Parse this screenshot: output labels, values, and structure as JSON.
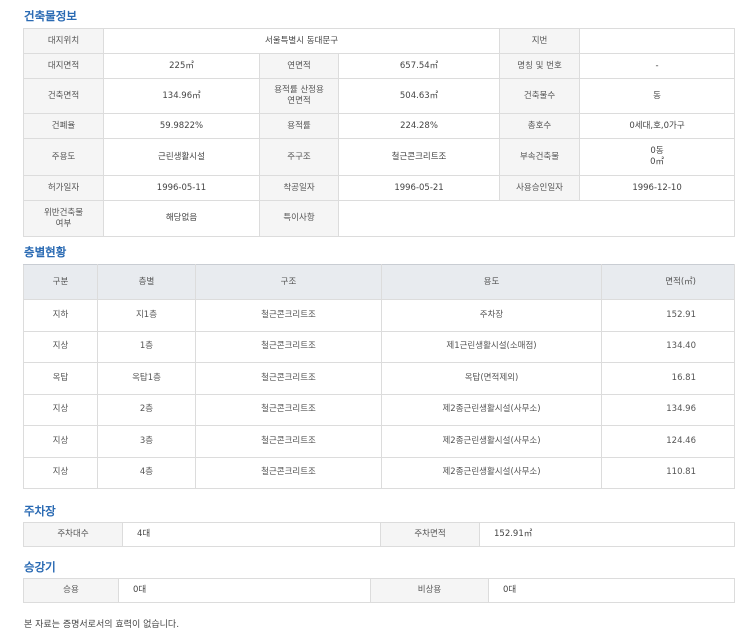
{
  "building": {
    "title": "건축물정보",
    "rows": [
      {
        "cells": [
          {
            "label": "대지위치",
            "value": "서울특별시 동대문구",
            "colspan": 3
          },
          {
            "label": "지번",
            "value": ""
          }
        ]
      },
      {
        "cells": [
          {
            "label": "대지면적",
            "value": "225㎡"
          },
          {
            "label": "연면적",
            "value": "657.54㎡"
          },
          {
            "label": "명칭 및 번호",
            "value": "-"
          }
        ]
      },
      {
        "cells": [
          {
            "label": "건축면적",
            "value": "134.96㎡"
          },
          {
            "label": "용적률 산정용\n연면적",
            "value": "504.63㎡"
          },
          {
            "label": "건축물수",
            "value": "동"
          }
        ]
      },
      {
        "cells": [
          {
            "label": "건폐율",
            "value": "59.9822%"
          },
          {
            "label": "용적률",
            "value": "224.28%"
          },
          {
            "label": "총호수",
            "value": "0세대,호,0가구"
          }
        ]
      },
      {
        "cells": [
          {
            "label": "주용도",
            "value": "근린생활시설"
          },
          {
            "label": "주구조",
            "value": "철근콘크리트조"
          },
          {
            "label": "부속건축물",
            "value": "0동\n0㎡"
          }
        ]
      },
      {
        "cells": [
          {
            "label": "허가일자",
            "value": "1996-05-11"
          },
          {
            "label": "착공일자",
            "value": "1996-05-21"
          },
          {
            "label": "사용승인일자",
            "value": "1996-12-10"
          }
        ]
      },
      {
        "cells": [
          {
            "label": "위반건축물\n여부",
            "value": "해당없음"
          },
          {
            "label": "특이사항",
            "value": "",
            "colspan": 3
          }
        ]
      }
    ]
  },
  "floors": {
    "title": "층별현황",
    "headers": [
      "구분",
      "층별",
      "구조",
      "용도",
      "면적(㎡)"
    ],
    "rows": [
      [
        "지하",
        "지1층",
        "철근콘크리트조",
        "주차장",
        "152.91"
      ],
      [
        "지상",
        "1층",
        "철근콘크리트조",
        "제1근린생활시설(소매점)",
        "134.40"
      ],
      [
        "옥탑",
        "옥탑1층",
        "철근콘크리트조",
        "옥탑(면적제외)",
        "16.81"
      ],
      [
        "지상",
        "2층",
        "철근콘크리트조",
        "제2종근린생활시설(사무소)",
        "134.96"
      ],
      [
        "지상",
        "3층",
        "철근콘크리트조",
        "제2종근린생활시설(사무소)",
        "124.46"
      ],
      [
        "지상",
        "4층",
        "철근콘크리트조",
        "제2종근린생활시설(사무소)",
        "110.81"
      ]
    ]
  },
  "parking": {
    "title": "주차장",
    "count_label": "주차대수",
    "count_value": "4대",
    "area_label": "주차면적",
    "area_value": "152.91㎡"
  },
  "elevator": {
    "title": "승강기",
    "passenger_label": "승용",
    "passenger_value": "0대",
    "emergency_label": "비상용",
    "emergency_value": "0대"
  },
  "note": "본 자료는 증명서로서의 효력이 없습니다."
}
